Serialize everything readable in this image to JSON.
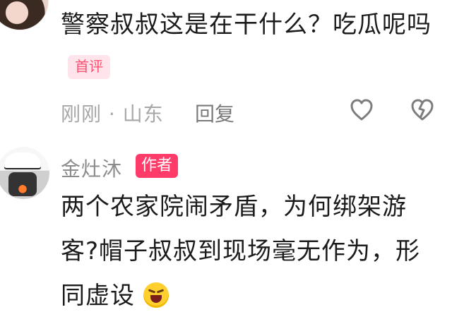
{
  "comment1": {
    "text": "警察叔叔这是在干什么？吃瓜呢吗",
    "badge": "首评",
    "meta": "刚刚 · 山东",
    "reply_label": "回复"
  },
  "comment2": {
    "author": "金灶沐",
    "author_badge": "作者",
    "text": "两个农家院闹矛盾，为何绑架游客?帽子叔叔到现场毫无作为，形同虚设",
    "emoji_icon": "grinning-face-with-sweat-icon"
  },
  "icons": {
    "like": "heart-outline-icon",
    "dislike": "broken-heart-outline-icon"
  }
}
